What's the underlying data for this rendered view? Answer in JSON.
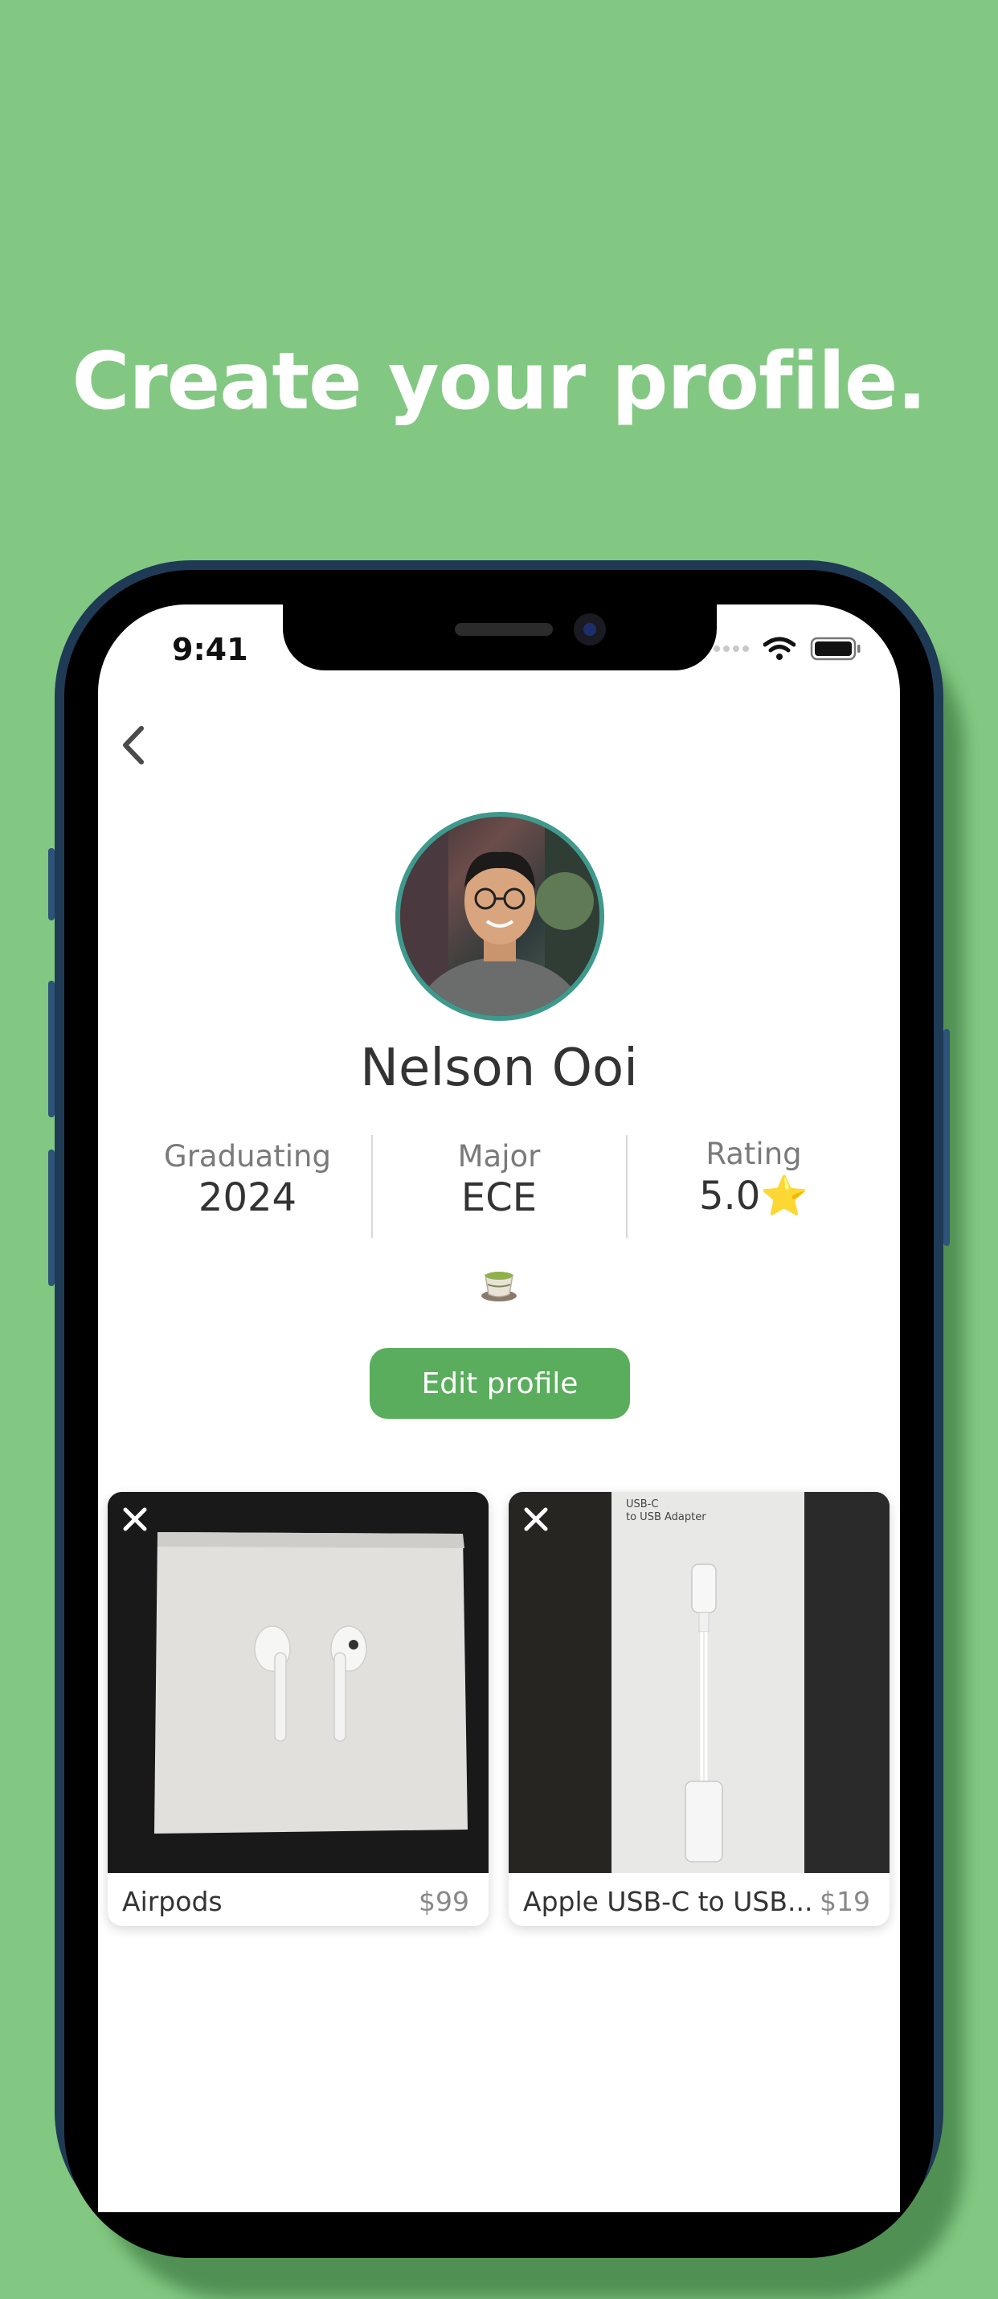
{
  "headline": "Create your profile.",
  "status_bar": {
    "time": "9:41"
  },
  "profile": {
    "name": "Nelson Ooi",
    "stats": [
      {
        "label": "Graduating",
        "value": "2024"
      },
      {
        "label": "Major",
        "value": "ECE"
      },
      {
        "label": "Rating",
        "value": "5.0⭐"
      }
    ],
    "edit_button": "Edit profile"
  },
  "listings": [
    {
      "title": "Airpods",
      "price": "$99"
    },
    {
      "title": "Apple USB-C to USB...",
      "price": "$19",
      "box_text": "USB-C\nto USB Adapter"
    }
  ],
  "icons": [
    "back-chevron-icon",
    "wifi-icon",
    "battery-icon",
    "signal-dots-icon",
    "close-icon",
    "tea-cup-icon"
  ],
  "colors": {
    "background": "#82c882",
    "accent": "#5aad5c",
    "avatar_ring": "#3e9a8c",
    "phone_frame": "#1f3a55"
  }
}
